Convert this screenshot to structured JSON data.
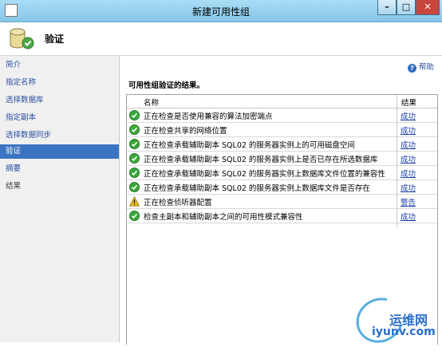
{
  "window": {
    "title": "新建可用性组",
    "min_label": "–",
    "max_label": "□",
    "close_label": "✕"
  },
  "header": {
    "title": "验证"
  },
  "sidebar": {
    "items": [
      {
        "label": "简介",
        "state": "link"
      },
      {
        "label": "指定名称",
        "state": "link"
      },
      {
        "label": "选择数据库",
        "state": "link"
      },
      {
        "label": "指定副本",
        "state": "link"
      },
      {
        "label": "选择数据同步",
        "state": "link"
      },
      {
        "label": "验证",
        "state": "active"
      },
      {
        "label": "摘要",
        "state": "link"
      },
      {
        "label": "结果",
        "state": "disabled"
      }
    ]
  },
  "main": {
    "help_label": "帮助",
    "section_title": "可用性组验证的结果。",
    "columns": {
      "name": "名称",
      "result": "结果"
    },
    "rows": [
      {
        "status": "success",
        "name": "正在检查是否使用兼容的算法加密端点",
        "result": "成功"
      },
      {
        "status": "success",
        "name": "正在检查共享的网络位置",
        "result": "成功"
      },
      {
        "status": "success",
        "name": "正在检查承载辅助副本 SQL02 的服务器实例上的可用磁盘空间",
        "result": "成功"
      },
      {
        "status": "success",
        "name": "正在检查承载辅助副本 SQL02 的服务器实例上是否已存在所选数据库",
        "result": "成功"
      },
      {
        "status": "success",
        "name": "正在检查承载辅助副本 SQL02 的服务器实例上数据库文件位置的兼容性",
        "result": "成功"
      },
      {
        "status": "success",
        "name": "正在检查承载辅助副本 SQL02 的服务器实例上数据库文件是否存在",
        "result": "成功"
      },
      {
        "status": "warning",
        "name": "正在检查侦听器配置",
        "result": "警告"
      },
      {
        "status": "success",
        "name": "检查主副本和辅助副本之间的可用性模式兼容性",
        "result": "成功"
      }
    ]
  },
  "watermark": {
    "cn": "运维网",
    "en": "iyunv.com"
  },
  "colors": {
    "success": "#3aa83a",
    "warning": "#f0c020",
    "link": "#1a3fa8",
    "active_nav": "#3b74c1"
  }
}
